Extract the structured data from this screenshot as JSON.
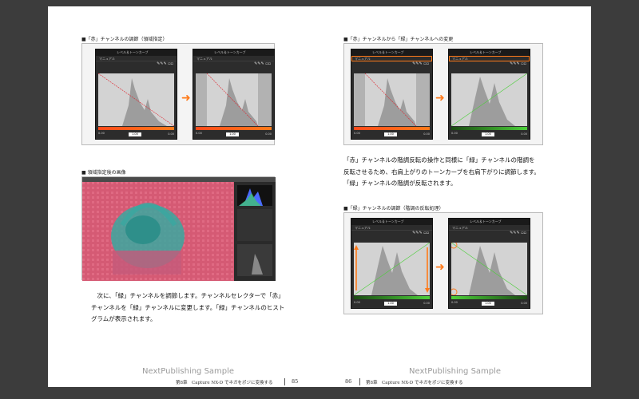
{
  "left_page": {
    "fig1_caption": "■「赤」チャンネルの調節（領域指定）",
    "fig2_caption": "■ 領域指定後の画像",
    "paragraph": [
      "　次に、「緑」チャンネルを調節します。チャンネルセレクターで「赤」",
      "チャンネルを「緑」チャンネルに変更します。「緑」チャンネルのヒスト",
      "グラムが表示されます。"
    ],
    "watermark": "NextPublishing Sample",
    "footer": "第8章　Capture NX-D でネガをポジに変換する",
    "page_number": "85"
  },
  "right_page": {
    "fig1_caption": "■「赤」チャンネルから「緑」チャンネルへの変更",
    "paragraph": [
      "「赤」チャンネルの階調反転の操作と同様に「緑」チャンネルの階調を",
      "反転させるため、右肩上がりのトーンカーブを右肩下がりに調節します。",
      "「緑」チャンネルの階調が反転されます。"
    ],
    "fig2_caption": "■「緑」チャンネルの調節（階調の反転処理）",
    "watermark": "NextPublishing Sample",
    "page_number": "86",
    "footer": "第8章　Capture NX-D でネガをポジに変換する"
  },
  "panel": {
    "title": "レベル＆トーンカーブ",
    "mode": "マニュアル",
    "low_value": "0.00",
    "box_value": "1.00",
    "high_value": "0.00"
  },
  "colors": {
    "accent_orange": "#ff7a1a",
    "panel_bg": "#2c2c2c",
    "red_curve": "#e0202a",
    "green_curve": "#4ccf3a"
  },
  "icons": [
    "arrow-right-icon",
    "eyedropper-icon",
    "histogram-icon"
  ]
}
